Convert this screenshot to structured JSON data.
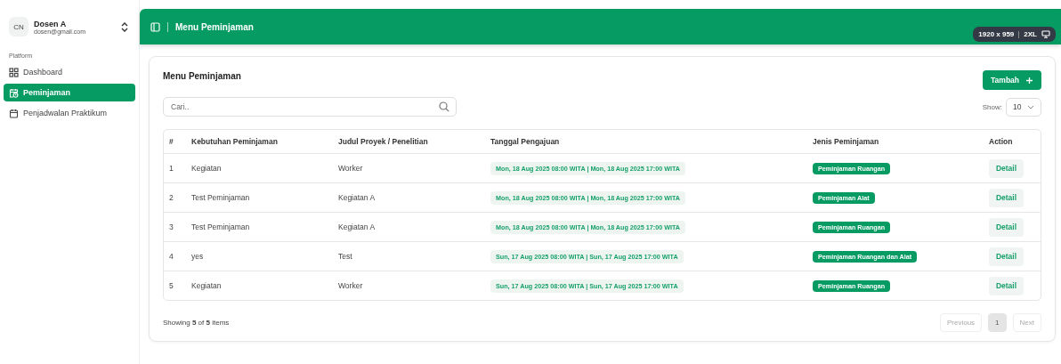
{
  "user": {
    "initials": "CN",
    "name": "Dosen A",
    "email": "dosen@gmail.com"
  },
  "sidebar": {
    "group": "Platform",
    "items": [
      {
        "label": "Dashboard",
        "selected": false
      },
      {
        "label": "Peminjaman",
        "selected": true
      },
      {
        "label": "Penjadwalan Praktikum",
        "selected": false
      }
    ]
  },
  "header": {
    "title": "Menu Peminjaman"
  },
  "screen_badge": {
    "size": "1920 x 959",
    "breakpoint": "2XL"
  },
  "card": {
    "title": "Menu Peminjaman",
    "add_button": "Tambah",
    "search": {
      "placeholder": "Cari.."
    },
    "show_label": "Show:",
    "show_value": "10"
  },
  "table": {
    "columns": [
      "#",
      "Kebutuhan Peminjaman",
      "Judul Proyek / Penelitian",
      "Tanggal Pengajuan",
      "Jenis Peminjaman",
      "Action"
    ],
    "rows": [
      {
        "no": "1",
        "kebutuhan": "Kegiatan",
        "judul": "Worker",
        "tanggal": "Mon, 18 Aug 2025 08:00 WITA | Mon, 18 Aug 2025 17:00 WITA",
        "jenis": "Peminjaman Ruangan",
        "action": "Detail"
      },
      {
        "no": "2",
        "kebutuhan": "Test Peminjaman",
        "judul": "Kegiatan A",
        "tanggal": "Mon, 18 Aug 2025 08:00 WITA | Mon, 18 Aug 2025 17:00 WITA",
        "jenis": "Peminjaman Alat",
        "action": "Detail"
      },
      {
        "no": "3",
        "kebutuhan": "Test Peminjaman",
        "judul": "Kegiatan A",
        "tanggal": "Mon, 18 Aug 2025 08:00 WITA | Mon, 18 Aug 2025 17:00 WITA",
        "jenis": "Peminjaman Ruangan",
        "action": "Detail"
      },
      {
        "no": "4",
        "kebutuhan": "yes",
        "judul": "Test",
        "tanggal": "Sun, 17 Aug 2025 08:00 WITA | Sun, 17 Aug 2025 17:00 WITA",
        "jenis": "Peminjaman Ruangan dan Alat",
        "action": "Detail"
      },
      {
        "no": "5",
        "kebutuhan": "Kegiatan",
        "judul": "Worker",
        "tanggal": "Sun, 17 Aug 2025 08:00 WITA | Sun, 17 Aug 2025 17:00 WITA",
        "jenis": "Peminjaman Ruangan",
        "action": "Detail"
      }
    ]
  },
  "footer": {
    "summary": "Showing **5** of **5** items",
    "pagination": [
      {
        "label": "Previous",
        "disabled": true,
        "selected": false
      },
      {
        "label": "1",
        "disabled": false,
        "selected": true
      },
      {
        "label": "Next",
        "disabled": true,
        "selected": false
      }
    ]
  }
}
